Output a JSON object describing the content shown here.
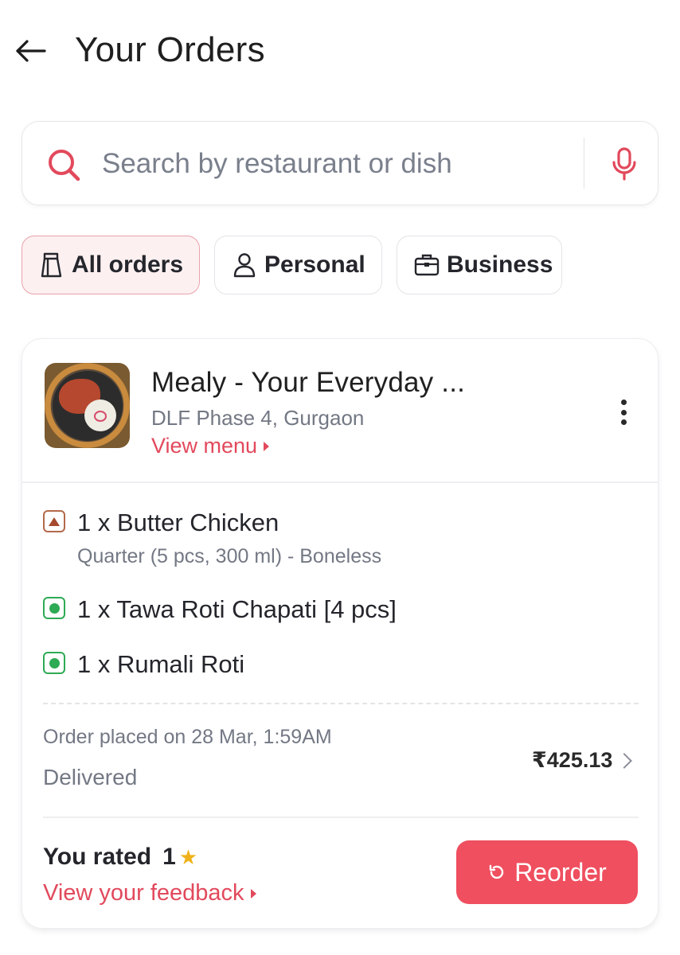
{
  "header": {
    "title": "Your Orders"
  },
  "search": {
    "placeholder": "Search by restaurant or dish",
    "value": ""
  },
  "filters": [
    {
      "label": "All orders",
      "icon": "bag-icon",
      "selected": true
    },
    {
      "label": "Personal",
      "icon": "person-icon",
      "selected": false
    },
    {
      "label": "Business",
      "icon": "briefcase-icon",
      "selected": false
    }
  ],
  "order": {
    "restaurant_name": "Mealy - Your Everyday ...",
    "location": "DLF Phase 4, Gurgaon",
    "view_menu_label": "View menu",
    "items": [
      {
        "name": "1 x Butter Chicken",
        "description": "Quarter (5 pcs, 300 ml) - Boneless",
        "type": "non-veg"
      },
      {
        "name": "1 x Tawa Roti Chapati [4 pcs]",
        "description": "",
        "type": "veg"
      },
      {
        "name": "1 x Rumali Roti",
        "description": "",
        "type": "veg"
      }
    ],
    "placed_on": "Order placed on 28 Mar, 1:59AM",
    "status": "Delivered",
    "total": "₹425.13",
    "rated_label": "You rated",
    "rating": "1",
    "view_feedback_label": "View your feedback",
    "reorder_label": "Reorder"
  },
  "colors": {
    "accent": "#ef4f5f",
    "accent_text": "#e2495c",
    "veg": "#2eaa54",
    "non_veg": "#a6492d",
    "star": "#f0b21a"
  }
}
